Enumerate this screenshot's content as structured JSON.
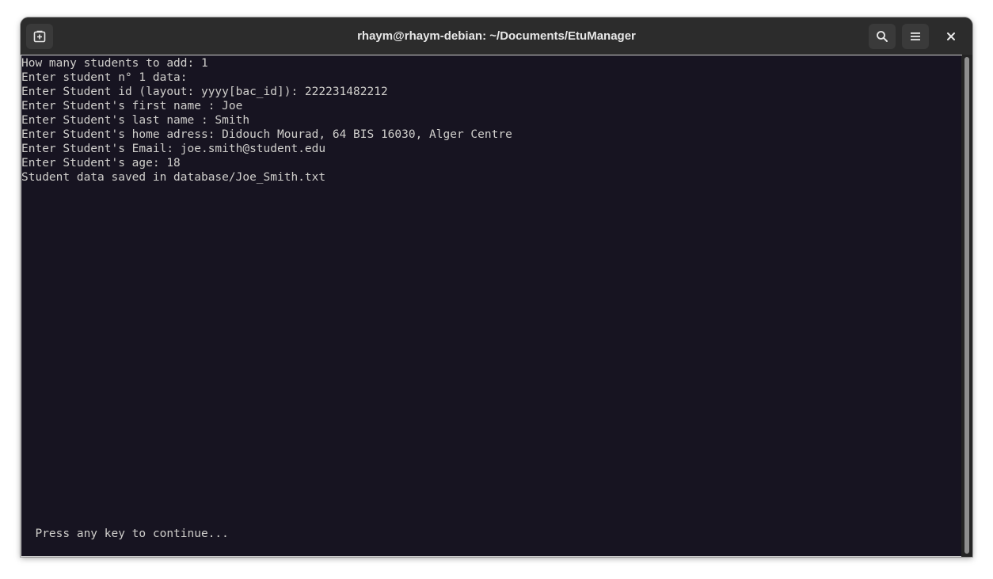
{
  "window": {
    "title": "rhaym@rhaym-debian: ~/Documents/EtuManager"
  },
  "header": {
    "new_tab_icon": "new-tab-icon",
    "search_icon": "search-icon",
    "menu_icon": "hamburger-menu-icon",
    "close_icon": "close-icon"
  },
  "terminal": {
    "lines": [
      "How many students to add: 1",
      "Enter student n° 1 data:",
      "Enter Student id (layout: yyyy[bac_id]): 222231482212",
      "Enter Student's first name : Joe",
      "Enter Student's last name : Smith",
      "Enter Student's home adress: Didouch Mourad, 64 BIS 16030, Alger Centre",
      "Enter Student's Email: joe.smith@student.edu",
      "Enter Student's age: 18",
      "Student data saved in database/Joe_Smith.txt"
    ],
    "prompt": "  Press any key to continue..."
  },
  "colors": {
    "terminal_bg": "#171421",
    "terminal_fg": "#d0cfcc",
    "titlebar_bg": "#2c2c2c",
    "button_bg": "#3a3a3a"
  }
}
